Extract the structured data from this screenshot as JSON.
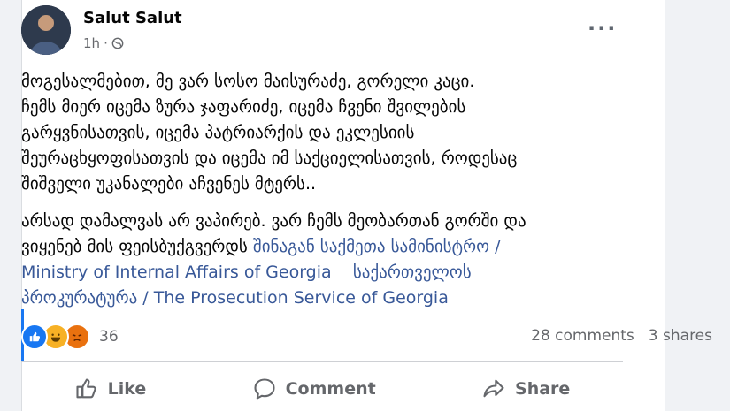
{
  "post": {
    "author": "Salut Salut",
    "time": "1h",
    "separator": "·",
    "more_label": "···",
    "paragraph1": "მოგესალმებით, მე ვარ სოსო მაისურაძე, გორელი კაცი.\nჩემს მიერ იცემა ზურა ჯაფარიძე, იცემა ჩვენი შვილების\nგარყვნისათვის, იცემა პატრიარქის და ეკლესიის\nშეურაცხყოფისათვის და იცემა იმ საქციელისათვის, როდესაც\nშიშველი უკანალები აჩვენეს მტერს..",
    "paragraph2_text": "არსად დამალვას არ ვაპირებ. ვარ ჩემს მეობართან გორში და\nვიყენებ მის ფეისბუქგვერდს ",
    "mention1": "შინაგან საქმეთა სამინისტრო /\nMinistry of Internal Affairs of Georgia",
    "mention_gap": "    ",
    "mention2": "საქართველოს\nპროკურატურა / The Prosecution Service of Georgia",
    "reaction_count": "36",
    "comments": "28 comments",
    "shares": "3 shares"
  },
  "actions": {
    "like": "Like",
    "comment": "Comment",
    "share": "Share"
  },
  "colors": {
    "link": "#385898",
    "like_blue": "#1877f2",
    "muted": "#65676b"
  }
}
